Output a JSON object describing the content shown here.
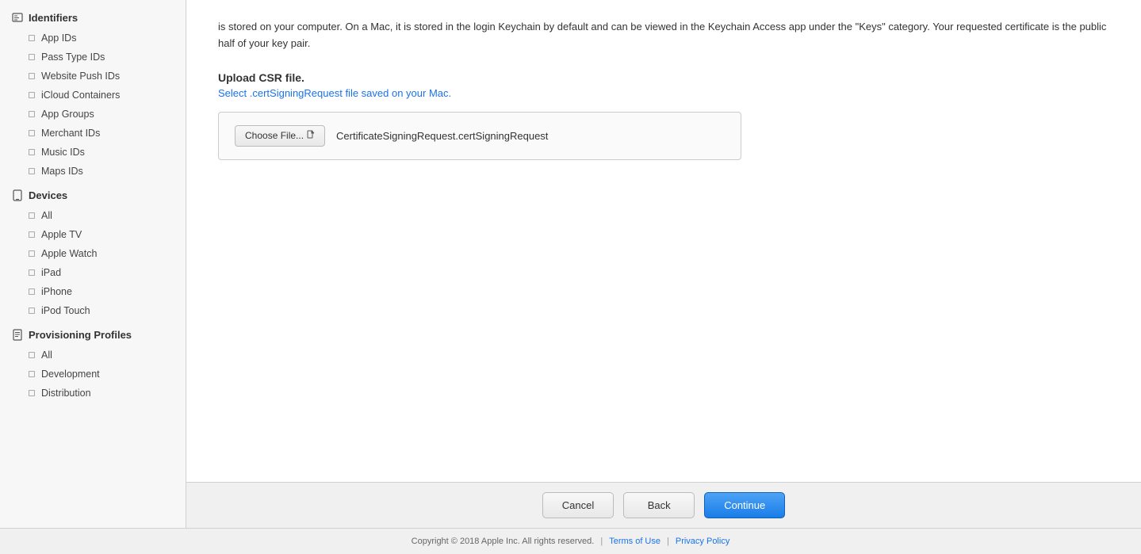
{
  "sidebar": {
    "sections": [
      {
        "id": "identifiers",
        "icon": "id-icon",
        "label": "Identifiers",
        "items": [
          {
            "id": "app-ids",
            "label": "App IDs"
          },
          {
            "id": "pass-type-ids",
            "label": "Pass Type IDs"
          },
          {
            "id": "website-push-ids",
            "label": "Website Push IDs"
          },
          {
            "id": "icloud-containers",
            "label": "iCloud Containers"
          },
          {
            "id": "app-groups",
            "label": "App Groups"
          },
          {
            "id": "merchant-ids",
            "label": "Merchant IDs"
          },
          {
            "id": "music-ids",
            "label": "Music IDs"
          },
          {
            "id": "maps-ids",
            "label": "Maps IDs"
          }
        ]
      },
      {
        "id": "devices",
        "icon": "device-icon",
        "label": "Devices",
        "items": [
          {
            "id": "all-devices",
            "label": "All"
          },
          {
            "id": "apple-tv",
            "label": "Apple TV"
          },
          {
            "id": "apple-watch",
            "label": "Apple Watch"
          },
          {
            "id": "ipad",
            "label": "iPad"
          },
          {
            "id": "iphone",
            "label": "iPhone"
          },
          {
            "id": "ipod-touch",
            "label": "iPod Touch"
          }
        ]
      },
      {
        "id": "provisioning-profiles",
        "icon": "profile-icon",
        "label": "Provisioning Profiles",
        "items": [
          {
            "id": "all-profiles",
            "label": "All"
          },
          {
            "id": "development",
            "label": "Development"
          },
          {
            "id": "distribution",
            "label": "Distribution"
          }
        ]
      }
    ]
  },
  "content": {
    "intro_text": "is stored on your computer. On a Mac, it is stored in the login Keychain by default and can be viewed in the Keychain Access app under the \"Keys\" category. Your requested certificate is the public half of your key pair.",
    "upload_title": "Upload CSR file.",
    "upload_subtitle_prefix": "Select ",
    "upload_subtitle_link": ".certSigningRequest",
    "upload_subtitle_suffix": " file saved on your Mac.",
    "choose_file_label": "Choose File...",
    "file_icon": "file-icon",
    "file_name": "CertificateSigningRequest.certSigningRequest"
  },
  "footer": {
    "cancel_label": "Cancel",
    "back_label": "Back",
    "continue_label": "Continue"
  },
  "page_footer": {
    "copyright": "Copyright © 2018 Apple Inc. All rights reserved.",
    "terms_label": "Terms of Use",
    "privacy_label": "Privacy Policy"
  }
}
